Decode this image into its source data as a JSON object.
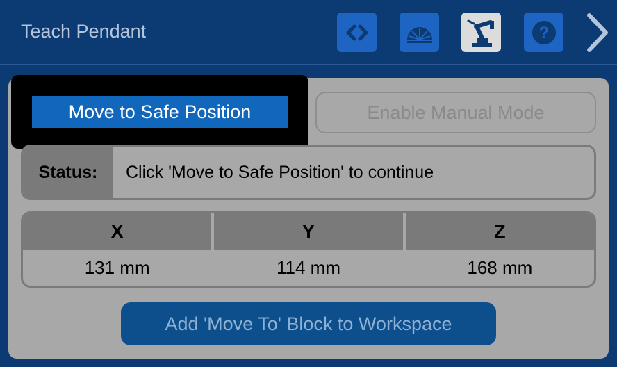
{
  "header": {
    "title": "Teach Pendant",
    "toolbar": [
      {
        "name": "code-icon",
        "active": false
      },
      {
        "name": "speed-gauge-icon",
        "active": false
      },
      {
        "name": "robot-arm-icon",
        "active": true
      },
      {
        "name": "help-icon",
        "active": false
      }
    ],
    "colors": {
      "bar": "#0c3a72",
      "button": "#1e64c2",
      "active_button": "#dcdcdc"
    }
  },
  "actions": {
    "safe_position_label": "Move to Safe Position",
    "manual_mode_label": "Enable Manual Mode",
    "add_block_label": "Add 'Move To' Block to Workspace"
  },
  "status": {
    "label": "Status:",
    "message": "Click 'Move to Safe Position' to continue"
  },
  "coordinates": {
    "headers": [
      "X",
      "Y",
      "Z"
    ],
    "values": [
      "131 mm",
      "114 mm",
      "168 mm"
    ]
  }
}
